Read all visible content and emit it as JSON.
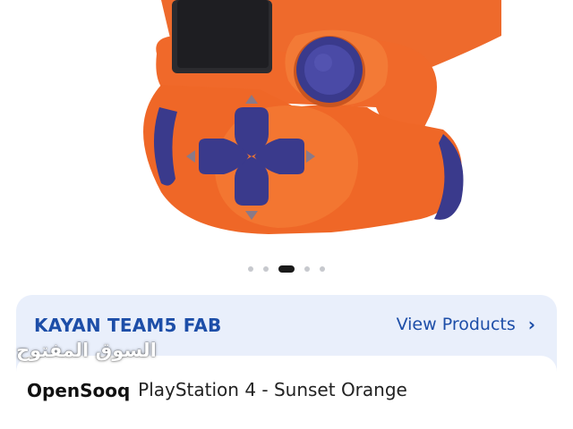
{
  "gallery": {
    "image_alt": "Orange PlayStation 4 controller close-up",
    "image_count": 5,
    "active_index": 2
  },
  "seller": {
    "name": "KAYAN TEAM5 FAB",
    "view_products_label": "View Products",
    "chevron_icon": "chevron-right-icon"
  },
  "listing": {
    "title_visible": "ntroller For PlayStation 4 - Sunset Orange"
  },
  "watermark": {
    "arabic": "السوق المفتوح",
    "latin": "OpenSooq"
  },
  "colors": {
    "accent": "#1d4ea8",
    "card_bg": "#e9effb",
    "controller_orange": "#f0692a",
    "controller_purple": "#3a3a8c"
  }
}
